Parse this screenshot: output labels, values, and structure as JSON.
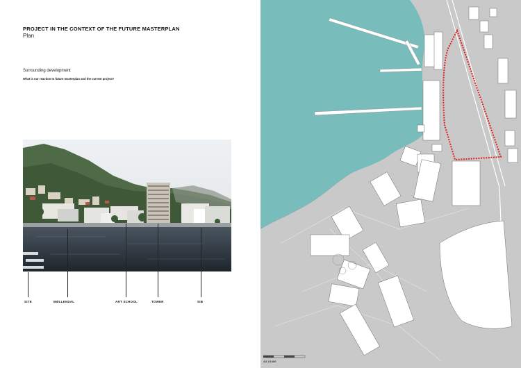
{
  "header": {
    "title": "PROJECT IN THE CONTEXT OF THE FUTURE MASTERPLAN",
    "subtitle": "Plan"
  },
  "section": {
    "heading": "Surrounding development",
    "question": "What is our reaction to future masterplan and the current project?"
  },
  "photo_labels": [
    "SITE",
    "MØLLENDAL",
    "ART SCHOOL",
    "TOWER",
    "SIB"
  ],
  "map": {
    "scale_label": "A3 1/1000",
    "water_color": "#79bcbc",
    "land_color": "#c9c9c9",
    "building_color": "#ffffff",
    "site_outline_color": "#e02020"
  }
}
